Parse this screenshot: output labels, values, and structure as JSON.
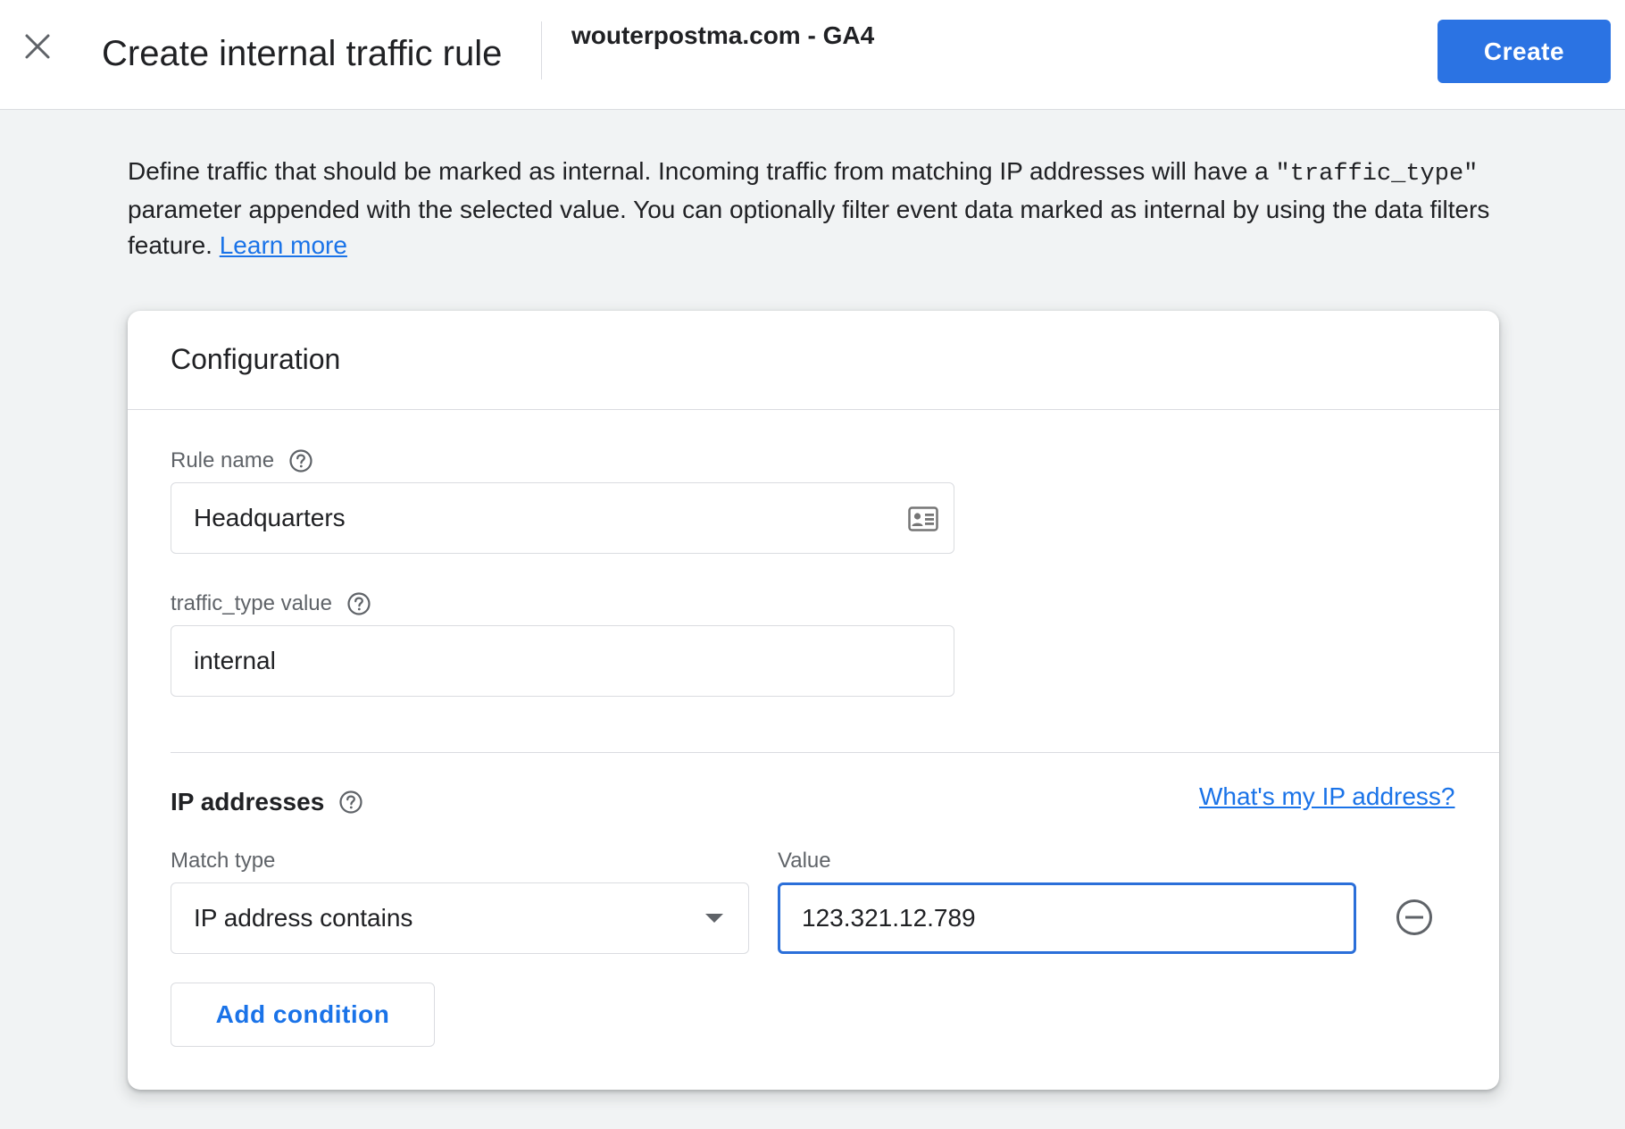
{
  "header": {
    "close_icon": "close-icon",
    "title": "Create internal traffic rule",
    "property": "wouterpostma.com - GA4",
    "create_label": "Create",
    "accent_color": "#2b73e3"
  },
  "intro": {
    "text_before_code": "Define traffic that should be marked as internal. Incoming traffic from matching IP addresses will have a ",
    "code": "\"traffic_type\"",
    "text_after_code": " parameter appended with the selected value. You can optionally filter event data marked as internal by using the data filters feature. ",
    "learn_more": "Learn more"
  },
  "configuration": {
    "title": "Configuration",
    "rule_name": {
      "label": "Rule name",
      "value": "Headquarters",
      "help_icon": "help-circle-icon",
      "trailing_icon": "contact-card-icon"
    },
    "traffic_type": {
      "label": "traffic_type value",
      "value": "internal",
      "help_icon": "help-circle-icon"
    }
  },
  "ip_addresses": {
    "title": "IP addresses",
    "help_icon": "help-circle-icon",
    "whats_my_ip": "What's my IP address?",
    "match_type_label": "Match type",
    "value_label": "Value",
    "conditions": [
      {
        "match_type": "IP address contains",
        "value": "123.321.12.789"
      }
    ],
    "remove_icon": "remove-circle-icon",
    "add_condition": "Add condition"
  }
}
